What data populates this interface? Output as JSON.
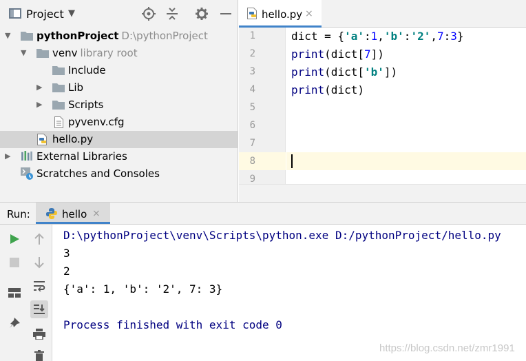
{
  "project_panel": {
    "title": "Project",
    "tree": [
      {
        "label": "pythonProject",
        "sub": "D:\\pythonProject"
      },
      {
        "label": "venv",
        "sub": "library root"
      },
      {
        "label": "Include"
      },
      {
        "label": "Lib"
      },
      {
        "label": "Scripts"
      },
      {
        "label": "pyvenv.cfg"
      },
      {
        "label": "hello.py"
      },
      {
        "label": "External Libraries"
      },
      {
        "label": "Scratches and Consoles"
      }
    ]
  },
  "editor": {
    "tab_label": "hello.py",
    "tab_close": "×",
    "line_numbers": [
      "1",
      "2",
      "3",
      "4",
      "5",
      "6",
      "7",
      "8",
      "9"
    ],
    "code": {
      "l1": {
        "a": "dict = {",
        "b": "'a'",
        "c": ":",
        "d": "1",
        "e": ",",
        "f": "'b'",
        "g": ":",
        "h": "'2'",
        "i": ",",
        "j": "7",
        "k": ":",
        "l": "3",
        "m": "}"
      },
      "l2": {
        "a": "print",
        "b": "(dict[",
        "c": "7",
        "d": "])"
      },
      "l3": {
        "a": "print",
        "b": "(dict[",
        "c": "'b'",
        "d": "])"
      },
      "l4": {
        "a": "print",
        "b": "(dict)"
      }
    }
  },
  "run_panel": {
    "label": "Run:",
    "tab_label": "hello",
    "tab_close": "×",
    "output": [
      "D:\\pythonProject\\venv\\Scripts\\python.exe D:/pythonProject/hello.py",
      "3",
      "2",
      "{'a': 1, 'b': '2', 7: 3}",
      "",
      "Process finished with exit code 0"
    ]
  },
  "watermark": "https://blog.csdn.net/zmr1991",
  "colors": {
    "accent": "#4083c9",
    "keyword": "#000080",
    "string": "#008080",
    "number": "#0000ff",
    "current_line": "#fffae3",
    "run_green": "#3fa34d"
  }
}
